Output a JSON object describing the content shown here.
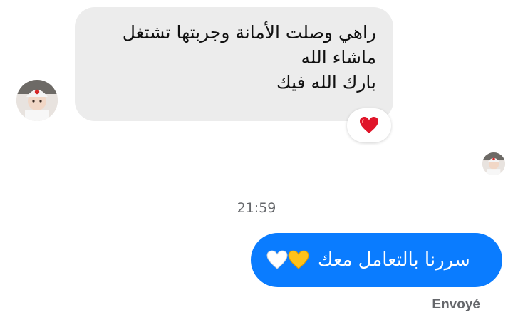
{
  "conversation": {
    "incoming": {
      "lines": [
        "راهي وصلت الأمانة وجربتها تشتغل",
        "ماشاء الله",
        "بارك الله فيك"
      ],
      "reaction_icon": "red-heart-icon"
    },
    "timestamp": "21:59",
    "outgoing": {
      "text": "سررنا بالتعامل معك",
      "emoji_icons": [
        "yellow-heart-icon",
        "white-heart-icon"
      ],
      "status": "Envoyé"
    }
  },
  "colors": {
    "incoming_bubble": "#ececec",
    "outgoing_bubble": "#0a7cff",
    "meta_text": "#65676b",
    "reaction_heart": "#e0152a",
    "yellow_heart": "#ffc21a"
  }
}
